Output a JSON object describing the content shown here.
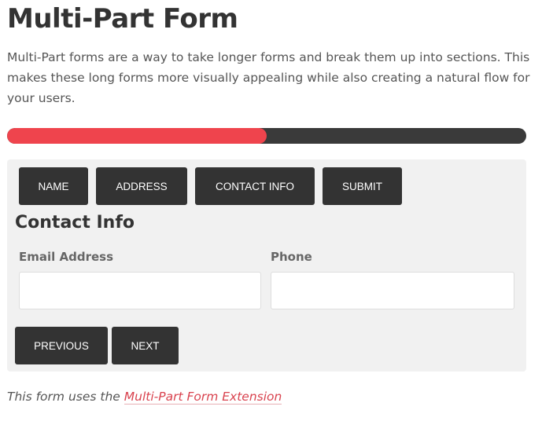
{
  "title": "Multi-Part Form",
  "intro": "Multi-Part forms are a way to take longer forms and break them up into sections. This makes these long forms more visually appealing while also creating a natural flow for your users.",
  "progress": {
    "percent": 50,
    "fill_color": "#ef444d",
    "track_color": "#3a3a3a"
  },
  "tabs": [
    {
      "label": "NAME"
    },
    {
      "label": "ADDRESS"
    },
    {
      "label": "CONTACT INFO"
    },
    {
      "label": "SUBMIT"
    }
  ],
  "section_title": "Contact Info",
  "fields": {
    "email": {
      "label": "Email Address",
      "value": ""
    },
    "phone": {
      "label": "Phone",
      "value": ""
    }
  },
  "buttons": {
    "previous": "PREVIOUS",
    "next": "NEXT"
  },
  "footer": {
    "text": "This form uses the ",
    "link": "Multi-Part Form Extension"
  }
}
